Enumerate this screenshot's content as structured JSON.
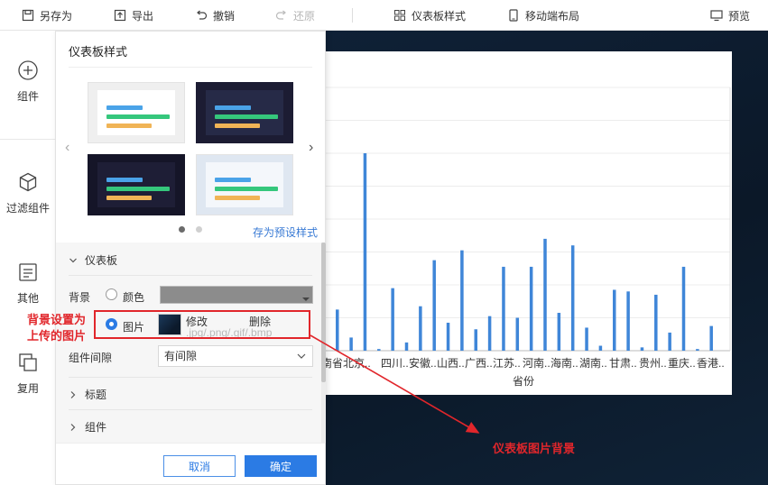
{
  "toolbar": {
    "save_as": "另存为",
    "export": "导出",
    "undo": "撤销",
    "redo": "还原",
    "dashboard_style": "仪表板样式",
    "mobile_layout": "移动端布局",
    "preview": "预览"
  },
  "sidebar": {
    "items": [
      {
        "label": "组件",
        "icon": "plus-circle-icon"
      },
      {
        "label": "过滤组件",
        "icon": "cube-icon"
      },
      {
        "label": "其他",
        "icon": "document-icon"
      },
      {
        "label": "复用",
        "icon": "copy-icon"
      }
    ]
  },
  "panel": {
    "title": "仪表板样式",
    "save_preset": "存为预设样式",
    "section_dashboard": "仪表板",
    "background_label": "背景",
    "option_color": "颜色",
    "option_image": "图片",
    "image_edit": "修改",
    "image_delete": "删除",
    "image_formats": ".jpg/.png/.gif/.bmp",
    "spacing_label": "组件间隙",
    "spacing_value": "有间隙",
    "section_title": "标题",
    "section_component": "组件",
    "cancel": "取消",
    "confirm": "确定",
    "selected_background": "image",
    "carousel_page": 1,
    "carousel_pages": 2
  },
  "annotations": {
    "left_note_line1": "背景设置为",
    "left_note_line2": "上传的图片",
    "right_note": "仪表板图片背景"
  },
  "colors": {
    "accent": "#2b7be4",
    "annotation": "#e1262b",
    "bar": "#3f86d8",
    "theme_blue": "#4aa3e8",
    "theme_green": "#35c77c",
    "theme_orange": "#f0b456"
  },
  "chart_data": {
    "type": "bar",
    "xlabel": "省份",
    "categories": [
      "云南省",
      "北京..",
      "四川..",
      "安徽..",
      "山西..",
      "广西..",
      "江苏..",
      "河南..",
      "海南..",
      "湖南..",
      "甘肃..",
      "贵州..",
      "重庆..",
      "香港.."
    ],
    "visible_tick_labels": [
      "云南省北京..",
      "四川..",
      "安徽..",
      "山西..",
      "广西..",
      "江苏..",
      "河南..",
      "海南..",
      "湖南..",
      "甘肃..",
      "贵州..",
      "重庆..",
      "香港.."
    ],
    "values": [
      25,
      8,
      120,
      1,
      38,
      5,
      27,
      55,
      17,
      61,
      13,
      21,
      51,
      20,
      51,
      68,
      23,
      64,
      14,
      3,
      37,
      36,
      2,
      34,
      11,
      51,
      1,
      15
    ],
    "ylim": [
      0,
      160
    ],
    "grid": true
  }
}
